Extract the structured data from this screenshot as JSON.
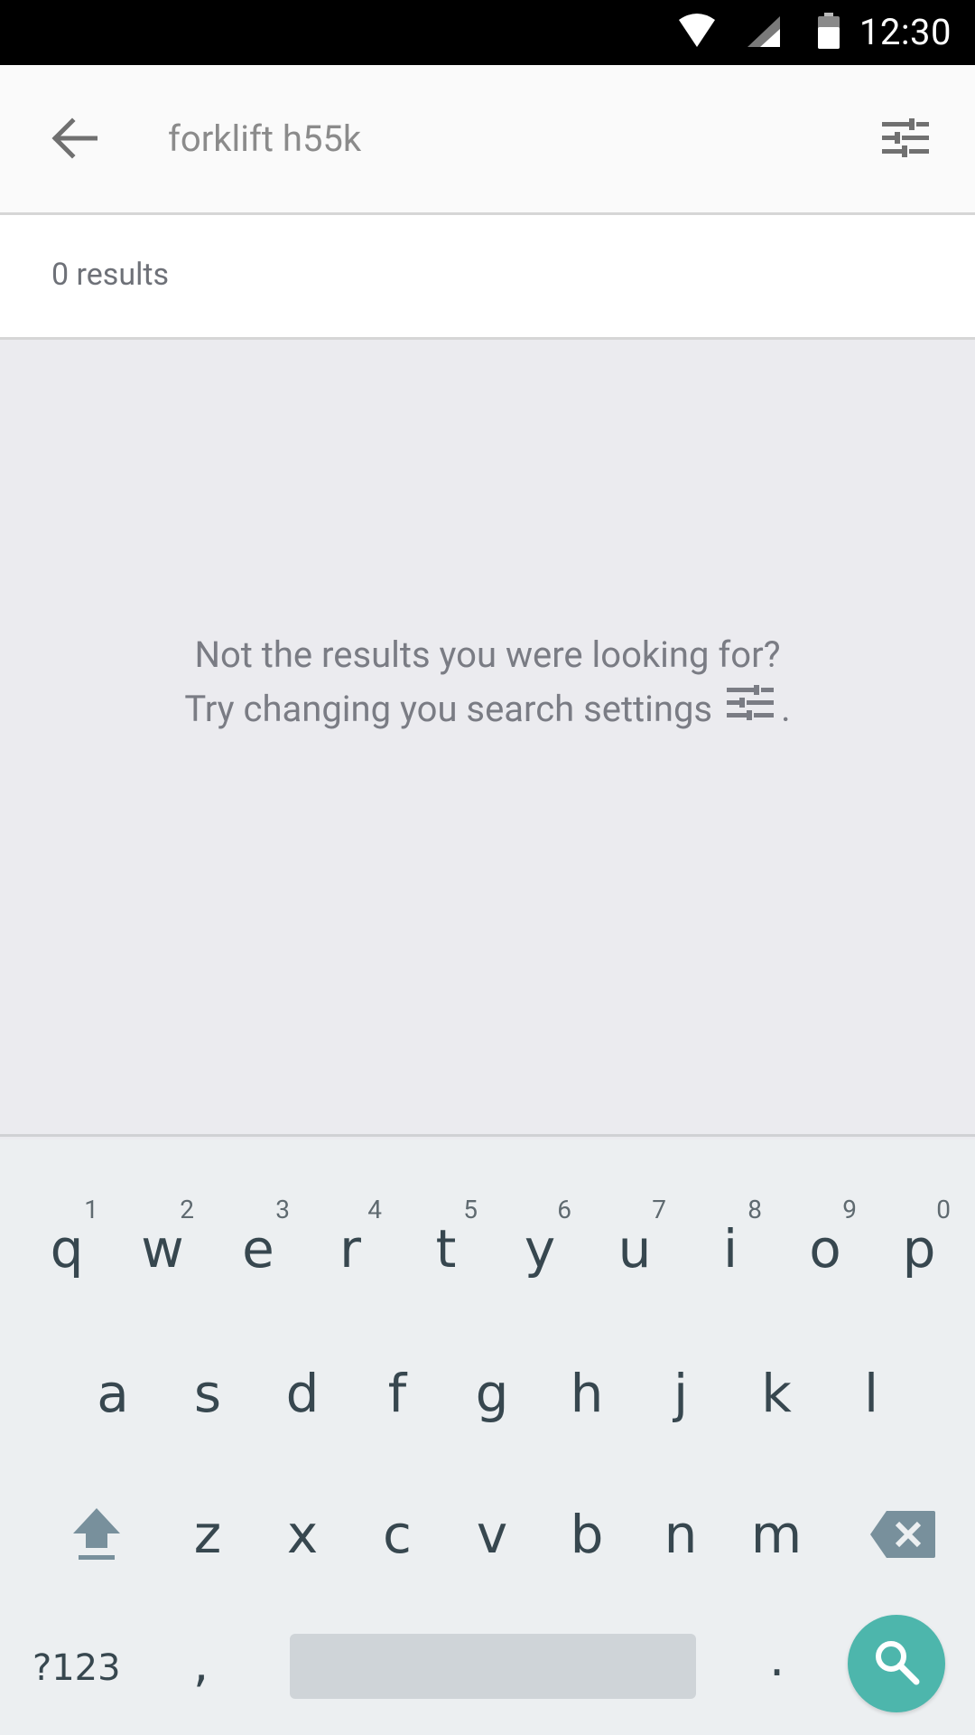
{
  "status_bar": {
    "time": "12:30",
    "icons": [
      "wifi-icon",
      "cell-signal-icon",
      "battery-icon"
    ]
  },
  "toolbar": {
    "back_icon": "arrow-back-icon",
    "query": "forklift h55k",
    "filter_icon": "tune-filter-icon"
  },
  "results": {
    "count_text": "0 results"
  },
  "empty_state": {
    "line1": "Not the results you were looking for?",
    "line2": "Try changing you search settings",
    "line2_suffix": ".",
    "icon": "tune-filter-icon"
  },
  "keyboard": {
    "row1": [
      {
        "letter": "q",
        "hint": "1"
      },
      {
        "letter": "w",
        "hint": "2"
      },
      {
        "letter": "e",
        "hint": "3"
      },
      {
        "letter": "r",
        "hint": "4"
      },
      {
        "letter": "t",
        "hint": "5"
      },
      {
        "letter": "y",
        "hint": "6"
      },
      {
        "letter": "u",
        "hint": "7"
      },
      {
        "letter": "i",
        "hint": "8"
      },
      {
        "letter": "o",
        "hint": "9"
      },
      {
        "letter": "p",
        "hint": "0"
      }
    ],
    "row2": [
      "a",
      "s",
      "d",
      "f",
      "g",
      "h",
      "j",
      "k",
      "l"
    ],
    "row3": [
      "z",
      "x",
      "c",
      "v",
      "b",
      "n",
      "m"
    ],
    "symbols_label": "?123",
    "comma_label": ",",
    "period_label": ".",
    "shift_icon": "shift-icon",
    "backspace_icon": "backspace-icon",
    "search_icon": "search-icon",
    "accent_color": "#4db6ac"
  }
}
